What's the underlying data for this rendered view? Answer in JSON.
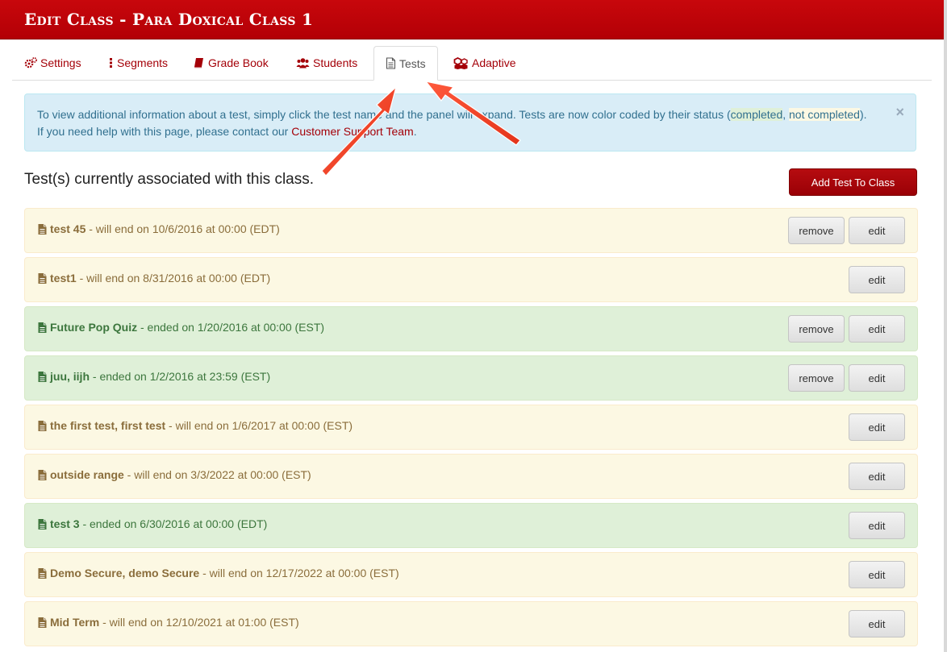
{
  "header": {
    "title": "Edit Class - Para Doxical Class 1"
  },
  "tabs": [
    {
      "label": "Settings",
      "icon": "cogs-icon"
    },
    {
      "label": "Segments",
      "icon": "list-icon"
    },
    {
      "label": "Grade Book",
      "icon": "book-icon"
    },
    {
      "label": "Students",
      "icon": "users-icon"
    },
    {
      "label": "Tests",
      "icon": "file-icon",
      "active": true
    },
    {
      "label": "Adaptive",
      "icon": "cubes-icon"
    }
  ],
  "alert": {
    "part1": "To view additional information about a test, simply click the test name and the panel will expand. Tests are now color coded by their status (",
    "completed": "completed",
    "comma": ", ",
    "not_completed": "not completed",
    "part2": "). If you need help with this page, please contact our ",
    "support_link": "Customer Support Team",
    "part3": ".",
    "close": "×"
  },
  "section": {
    "heading": "Test(s) currently associated with this class.",
    "add_button": "Add Test To Class"
  },
  "buttons": {
    "remove": "remove",
    "edit": "edit"
  },
  "colors": {
    "brand_red": "#b30006",
    "pending_bg": "#fcf8e3",
    "completed_bg": "#dff0d8",
    "info_bg": "#d9edf7"
  },
  "tests": [
    {
      "name": "test 45",
      "desc": " - will end on 10/6/2016 at 00:00 (EDT)",
      "status": "pending",
      "removable": true
    },
    {
      "name": "test1",
      "desc": " - will end on 8/31/2016 at 00:00 (EDT)",
      "status": "pending",
      "removable": false
    },
    {
      "name": "Future Pop Quiz",
      "desc": " - ended on 1/20/2016 at 00:00 (EST)",
      "status": "completed",
      "removable": true
    },
    {
      "name": "juu, iijh",
      "desc": " - ended on 1/2/2016 at 23:59 (EST)",
      "status": "completed",
      "removable": true
    },
    {
      "name": "the first test, first test",
      "desc": " - will end on 1/6/2017 at 00:00 (EST)",
      "status": "pending",
      "removable": false
    },
    {
      "name": "outside range",
      "desc": " - will end on 3/3/2022 at 00:00 (EST)",
      "status": "pending",
      "removable": false
    },
    {
      "name": "test 3",
      "desc": " - ended on 6/30/2016 at 00:00 (EDT)",
      "status": "completed",
      "removable": false
    },
    {
      "name": "Demo Secure, demo Secure",
      "desc": " - will end on 12/17/2022 at 00:00 (EST)",
      "status": "pending",
      "removable": false
    },
    {
      "name": "Mid Term",
      "desc": " - will end on 12/10/2021 at 01:00 (EST)",
      "status": "pending",
      "removable": false
    }
  ]
}
